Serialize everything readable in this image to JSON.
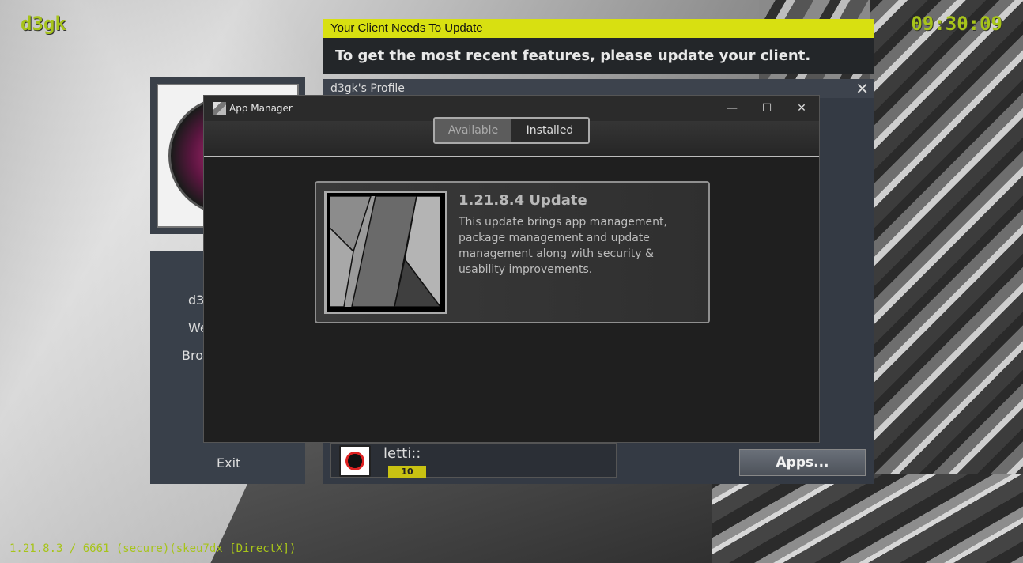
{
  "brand": "d3gk",
  "clock": "09:30:09",
  "version": "1.21.8.3 / 6661 (secure)(skeu7dx [DirectX])",
  "banner": {
    "title": "Your Client Needs To Update",
    "message": "To get the most recent features, please update your client."
  },
  "profile": {
    "title": "d3gk's Profile",
    "close_icon": "close-icon"
  },
  "side_menu": {
    "items": [
      "d3",
      "We",
      "Bro"
    ],
    "exit": "Exit"
  },
  "friend": {
    "name": "letti::",
    "level": "10"
  },
  "apps_button": "Apps...",
  "app_manager": {
    "title": "App Manager",
    "controls": {
      "minimize": "—",
      "maximize": "☐",
      "close": "✕"
    },
    "tabs": [
      {
        "label": "Available",
        "active": true
      },
      {
        "label": "Installed",
        "active": false
      }
    ],
    "update": {
      "title": "1.21.8.4 Update",
      "description": "This update brings app management, package management and update management along with security & usability improvements."
    }
  },
  "colors": {
    "accent_green": "#a7c41a",
    "banner_yellow": "#d8e011"
  }
}
